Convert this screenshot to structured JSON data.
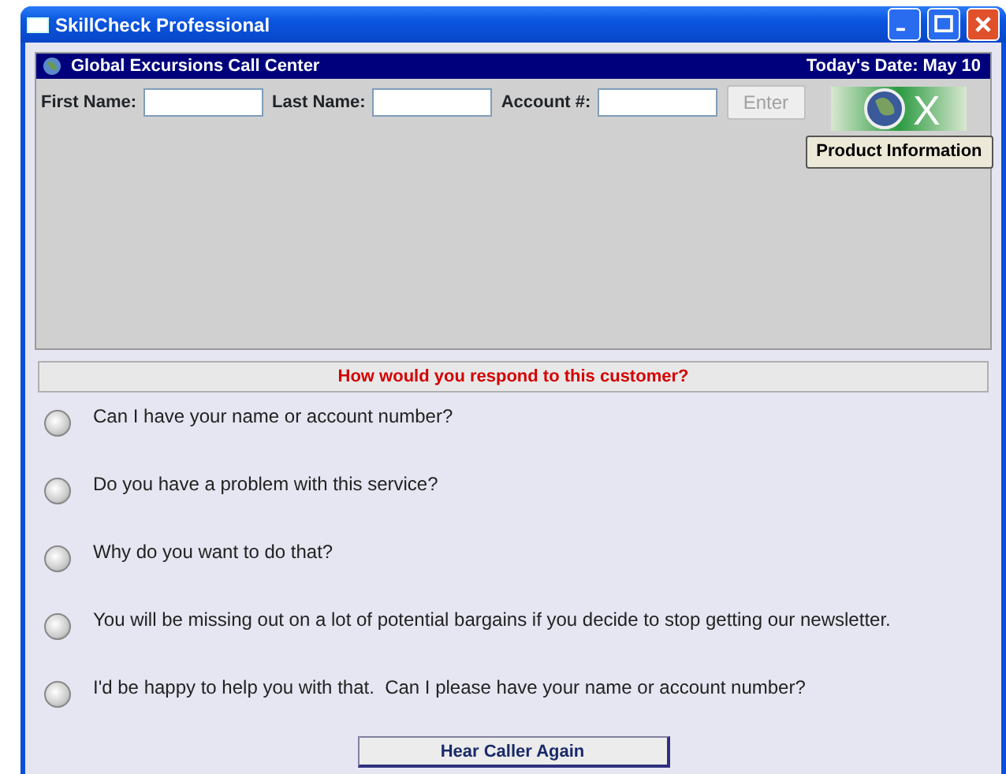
{
  "window": {
    "title": "SkillCheck Professional"
  },
  "header": {
    "title": "Global Excursions Call Center",
    "date": "Today's Date: May 10"
  },
  "form": {
    "fields": [
      {
        "label": "First Name:"
      },
      {
        "label": "Last Name:"
      },
      {
        "label": "Account #:"
      }
    ],
    "enter_button": {
      "label": "Enter",
      "disabled": true
    }
  },
  "logo": {
    "text": "X"
  },
  "product_button": "Product Information",
  "question": "How would you respond to this customer?",
  "options": [
    {
      "text": "Can I have your name or account number?",
      "selected": false
    },
    {
      "text": "Do you have a problem with this service?",
      "selected": false
    },
    {
      "text": "Why do you want to do that?",
      "selected": false
    },
    {
      "text": "You will be missing out on a lot of potential bargains if you decide to stop getting our newsletter.",
      "selected": false
    },
    {
      "text": "I'd be happy to help you with that.  Can I please have your name or account number?",
      "selected": false
    }
  ],
  "replay_button": "Hear Caller Again"
}
